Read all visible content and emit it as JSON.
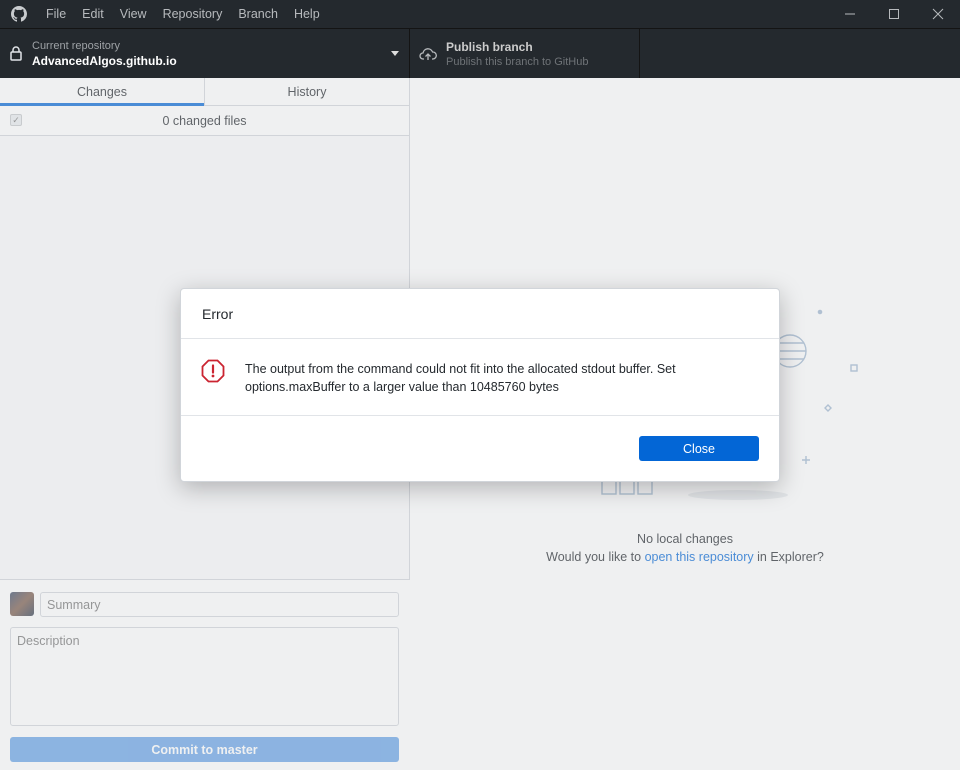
{
  "menu": [
    "File",
    "Edit",
    "View",
    "Repository",
    "Branch",
    "Help"
  ],
  "window_controls": {
    "minimize": "─",
    "maximize": "☐",
    "close": "✕"
  },
  "toolbar": {
    "repo_label": "Current repository",
    "repo_name": "AdvancedAlgos.github.io",
    "publish_title": "Publish branch",
    "publish_subtitle": "Publish this branch to GitHub"
  },
  "tabs": [
    {
      "label": "Changes",
      "selected": true
    },
    {
      "label": "History",
      "selected": false
    }
  ],
  "changes": {
    "count_text": "0 changed files"
  },
  "commit": {
    "summary_placeholder": "Summary",
    "description_placeholder": "Description",
    "button_prefix": "Commit to ",
    "branch": "master"
  },
  "empty_state": {
    "title": "No local changes",
    "prompt_before": "Would you like to ",
    "link": "open this repository",
    "prompt_after": " in Explorer?"
  },
  "dialog": {
    "title": "Error",
    "message": "The output from the command could not fit into the allocated stdout buffer. Set options.maxBuffer to a larger value than 10485760 bytes",
    "close_label": "Close"
  },
  "colors": {
    "accent": "#0366d6",
    "titlebar": "#24292e",
    "error": "#cb2431"
  }
}
